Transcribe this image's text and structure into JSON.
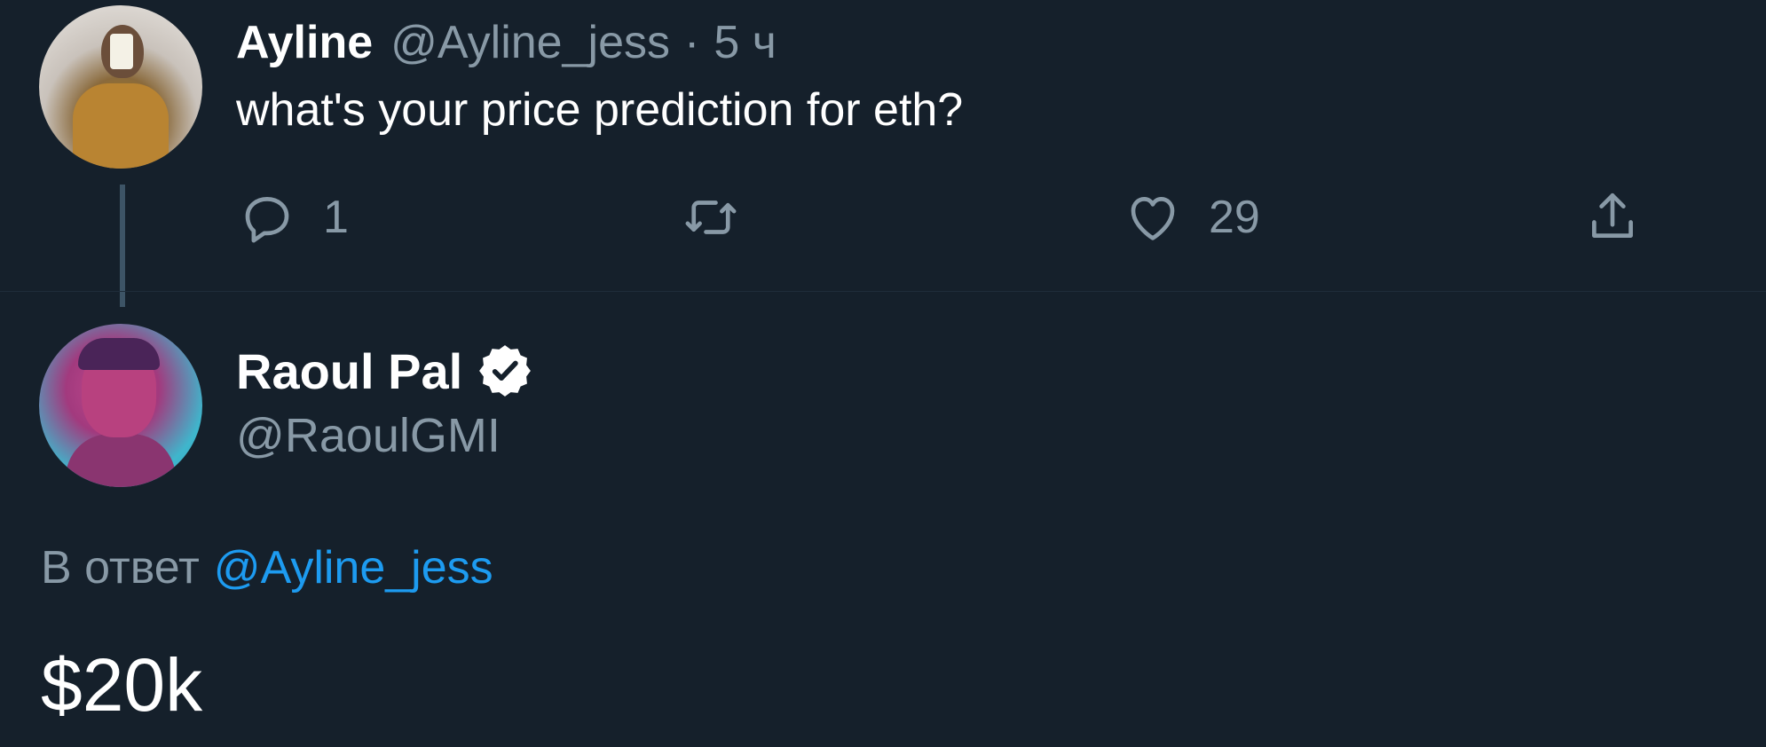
{
  "original_tweet": {
    "author_name": "Ayline",
    "handle": "@Ayline_jess",
    "separator": "·",
    "time": "5 ч",
    "text": "what's your price prediction for eth?",
    "avatar_icon": "user-photo",
    "actions": {
      "reply": {
        "icon": "reply-icon",
        "count": "1"
      },
      "retweet": {
        "icon": "retweet-icon",
        "count": ""
      },
      "like": {
        "icon": "heart-icon",
        "count": "29"
      },
      "share": {
        "icon": "share-icon"
      }
    }
  },
  "reply_tweet": {
    "author_name": "Raoul Pal",
    "verified": true,
    "handle": "@RaoulGMI",
    "avatar_icon": "user-photo",
    "replying_to_prefix": "В ответ",
    "replying_to_handle": "@Ayline_jess",
    "text": "$20k"
  },
  "colors": {
    "background": "#15202b",
    "secondary_text": "#8899a6",
    "mention": "#1d9bf0",
    "thread_line": "#3d5466"
  }
}
